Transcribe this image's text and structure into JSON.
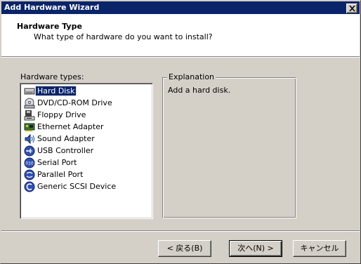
{
  "window": {
    "title": "Add Hardware Wizard"
  },
  "header": {
    "title": "Hardware Type",
    "subtitle": "What type of hardware do you want to install?"
  },
  "hardware_list": {
    "label": "Hardware types:",
    "selected_index": 0,
    "items": [
      {
        "label": "Hard Disk",
        "icon": "hard-disk-icon"
      },
      {
        "label": "DVD/CD-ROM Drive",
        "icon": "dvd-cdrom-icon"
      },
      {
        "label": "Floppy Drive",
        "icon": "floppy-drive-icon"
      },
      {
        "label": "Ethernet Adapter",
        "icon": "ethernet-adapter-icon"
      },
      {
        "label": "Sound Adapter",
        "icon": "sound-adapter-icon"
      },
      {
        "label": "USB Controller",
        "icon": "usb-controller-icon"
      },
      {
        "label": "Serial Port",
        "icon": "serial-port-icon"
      },
      {
        "label": "Parallel Port",
        "icon": "parallel-port-icon"
      },
      {
        "label": "Generic SCSI Device",
        "icon": "scsi-device-icon"
      }
    ]
  },
  "explanation": {
    "legend": "Explanation",
    "text": "Add a hard disk."
  },
  "buttons": {
    "back": "< 戻る(B)",
    "next": "次へ(N) >",
    "cancel": "キャンセル"
  },
  "colors": {
    "titlebar": "#0a246a",
    "face": "#d4d0c8",
    "selection": "#0a246a"
  }
}
